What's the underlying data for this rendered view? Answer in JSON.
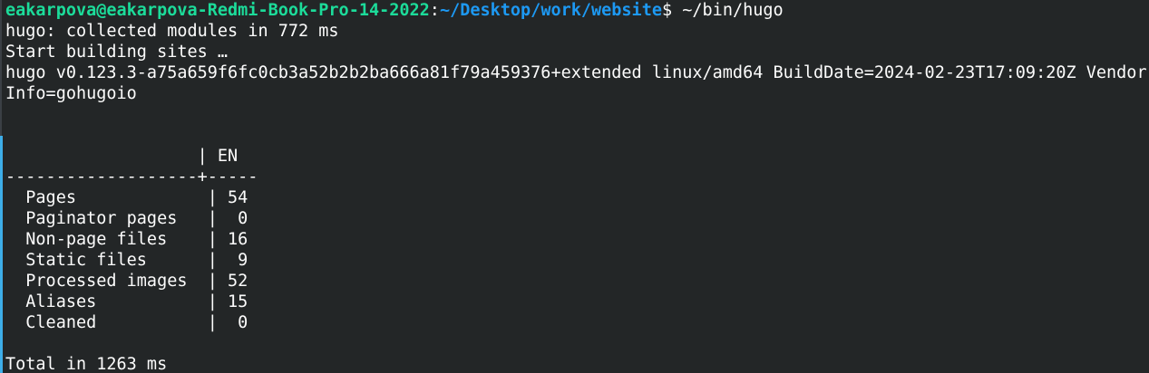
{
  "prompt": {
    "user_host": "eakarpova@eakarpova-Redmi-Book-Pro-14-2022",
    "separator": ":",
    "path": "~/Desktop/work/website",
    "symbol": "$",
    "command": " ~/bin/hugo"
  },
  "output": {
    "line1": "hugo: collected modules in 772 ms",
    "line2": "Start building sites …",
    "line3": "hugo v0.123.3-a75a659f6fc0cb3a52b2b2ba666a81f79a459376+extended linux/amd64 BuildDate=2024-02-23T17:09:20Z Vendor",
    "line4": "Info=gohugoio"
  },
  "table": {
    "header": "                   | EN",
    "divider": "-------------------+-----",
    "rows": [
      "  Pages             | 54",
      "  Paginator pages   |  0",
      "  Non-page files    | 16",
      "  Static files      |  9",
      "  Processed images  | 52",
      "  Aliases           | 15",
      "  Cleaned           |  0"
    ]
  },
  "total": "Total in 1263 ms",
  "colors": {
    "background": "#232627",
    "foreground": "#fcfcfc",
    "user": "#1cdc9a",
    "path": "#1d99f3"
  }
}
